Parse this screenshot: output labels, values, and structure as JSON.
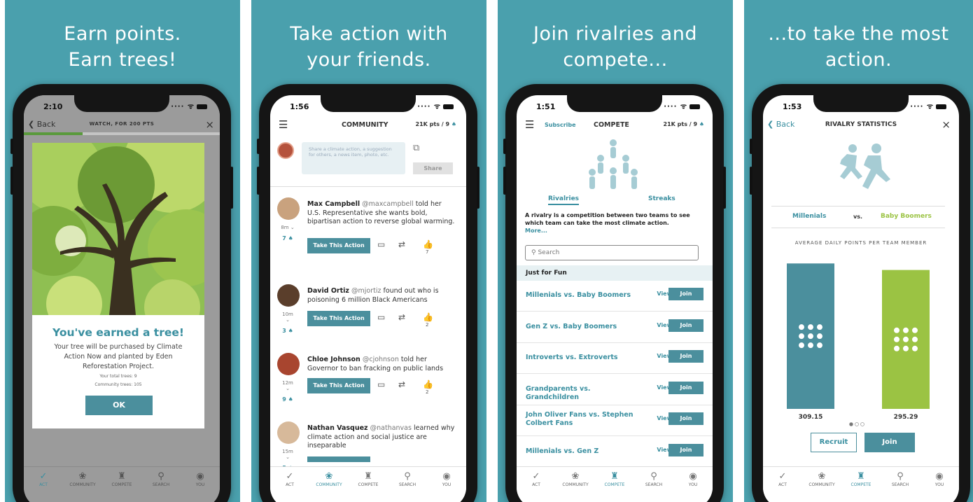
{
  "colors": {
    "brand": "#4aa0ad",
    "teal": "#3a8fa0",
    "green": "#9bc343"
  },
  "panels": [
    {
      "headline": [
        "Earn points.",
        "Earn trees!"
      ]
    },
    {
      "headline": [
        "Take action with",
        "your friends."
      ]
    },
    {
      "headline": [
        "Join rivalries and",
        "compete..."
      ]
    },
    {
      "headline": [
        "...to take the most",
        "action."
      ]
    }
  ],
  "tabs": [
    "ACT",
    "COMMUNITY",
    "COMPETE",
    "SEARCH",
    "YOU"
  ],
  "screen1": {
    "time": "2:10",
    "back": "Back",
    "title": "WATCH, FOR 200 PTS",
    "close": "×",
    "progress": 0.3,
    "heading": "You've earned a tree!",
    "body": "Your tree will be purchased by Climate Action Now and planted by Eden Reforestation Project.",
    "total_trees": "Your total trees: 9",
    "community_trees": "Community trees: 105",
    "ok": "OK"
  },
  "screen2": {
    "time": "1:56",
    "title": "COMMUNITY",
    "points": "21K pts / 9",
    "placeholder": "Share a climate action, a suggestion for others, a news item, photo, etc.",
    "share": "Share",
    "take_action": "Take This Action",
    "posts": [
      {
        "name": "Max Campbell",
        "handle": "@maxcampbell",
        "text": "told her U.S. Representative she wants bold, bipartisan action to reverse global warming.",
        "ago": "8m",
        "trees": "7",
        "likes": "7"
      },
      {
        "name": "David Ortiz",
        "handle": "@mjortiz",
        "text": "found out who is poisoning 6 million Black Americans",
        "ago": "10m",
        "trees": "3",
        "likes": "2"
      },
      {
        "name": "Chloe Johnson",
        "handle": "@cjohnson",
        "text": "told her Governor to ban fracking on public lands",
        "ago": "12m",
        "trees": "9",
        "likes": "2"
      },
      {
        "name": "Nathan Vasquez",
        "handle": "@nathanvas",
        "text": "learned why climate action and social justice are inseparable",
        "ago": "15m",
        "trees": "5",
        "likes": ""
      }
    ]
  },
  "screen3": {
    "time": "1:51",
    "subscribe": "Subscribe",
    "title": "COMPETE",
    "points": "21K pts / 9",
    "tab_rivalries": "Rivalries",
    "tab_streaks": "Streaks",
    "desc": "A rivalry is a competition between two teams to see which team can take the most climate action.",
    "more": "More...",
    "search": "Search",
    "section": "Just for Fun",
    "view": "View",
    "join": "Join",
    "rivalries": [
      "Millenials vs. Baby Boomers",
      "Gen Z vs. Baby Boomers",
      "Introverts vs. Extroverts",
      "Grandparents vs. Grandchildren",
      "John Oliver Fans vs. Stephen Colbert Fans",
      "Millenials vs. Gen Z"
    ]
  },
  "screen4": {
    "time": "1:53",
    "back": "Back",
    "title": "RIVALRY STATISTICS",
    "close": "×",
    "team_a": "Millenials",
    "vs": "vs.",
    "team_b": "Baby Boomers",
    "subtitle": "AVERAGE DAILY POINTS PER TEAM MEMBER",
    "recruit": "Recruit",
    "join": "Join"
  },
  "chart_data": {
    "type": "bar",
    "categories": [
      "Millenials",
      "Baby Boomers"
    ],
    "values": [
      309.15,
      295.29
    ],
    "labels": [
      "309.15",
      "295.29"
    ],
    "title": "AVERAGE DAILY POINTS PER TEAM MEMBER",
    "colors": [
      "#4b8f9d",
      "#9bc343"
    ],
    "ylim": [
      0,
      320
    ]
  }
}
